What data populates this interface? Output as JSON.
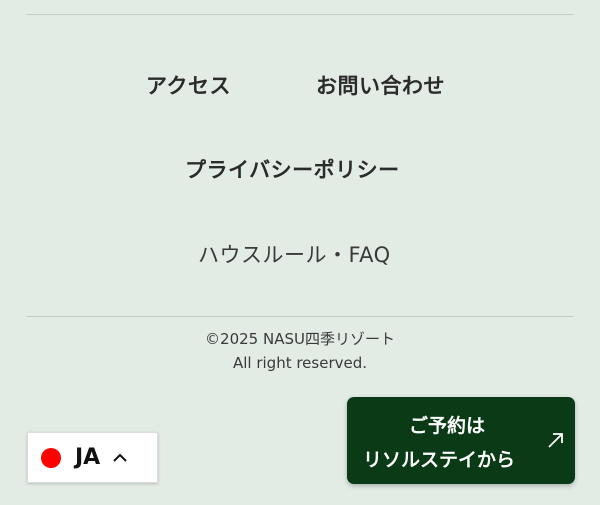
{
  "footer": {
    "links": {
      "access": "アクセス",
      "contact": "お問い合わせ",
      "privacy": "プライバシーポリシー",
      "house_rules": "ハウスルール・FAQ"
    },
    "copyright_line1": "©2025 NASU四季リゾート",
    "copyright_line2": "All right reserved."
  },
  "language_switcher": {
    "code": "JA",
    "flag_color": "#ff0000",
    "icon": "chevron-up-icon"
  },
  "cta": {
    "line1": "ご予約は",
    "line2": "リソルステイから",
    "icon": "arrow-up-right-icon",
    "color": "#0a3a16"
  }
}
